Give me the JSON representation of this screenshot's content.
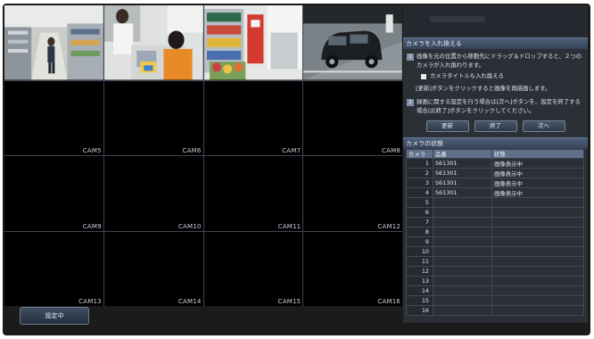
{
  "grid": {
    "cameras": [
      {
        "label": ""
      },
      {
        "label": ""
      },
      {
        "label": ""
      },
      {
        "label": ""
      },
      {
        "label": "CAM5"
      },
      {
        "label": "CAM6"
      },
      {
        "label": "CAM7"
      },
      {
        "label": "CAM8"
      },
      {
        "label": "CAM9"
      },
      {
        "label": "CAM10"
      },
      {
        "label": "CAM11"
      },
      {
        "label": "CAM12"
      },
      {
        "label": "CAM13"
      },
      {
        "label": "CAM14"
      },
      {
        "label": "CAM15"
      },
      {
        "label": "CAM16"
      }
    ]
  },
  "status_button": "設定中",
  "swap_section": {
    "header": "カメラを入れ換える",
    "step1_num": "1",
    "step1_text": "画像を元の位置から移動先にドラッグ＆ドロップすると、２つのカメラが入れ換わります。",
    "checkbox_label": "カメラタイトルも入れ換える",
    "refresh_note": "[更新]ボタンをクリックすると画像を再描画します。",
    "step2_num": "2",
    "step2_text": "録画に関する設定を行う場合は[次へ]ボタンを、設定を終了する場合は[終了]ボタンをクリックしてください。",
    "buttons": {
      "refresh": "更新",
      "finish": "終了",
      "next": "次へ"
    }
  },
  "status_section": {
    "header": "カメラの状態",
    "columns": {
      "camera": "カメラ",
      "model": "品番",
      "state": "状態"
    },
    "rows": [
      {
        "num": "1",
        "model": "S61301",
        "state": "画像表示中"
      },
      {
        "num": "2",
        "model": "S61301",
        "state": "画像表示中"
      },
      {
        "num": "3",
        "model": "S61301",
        "state": "画像表示中"
      },
      {
        "num": "4",
        "model": "S61301",
        "state": "画像表示中"
      },
      {
        "num": "5",
        "model": "",
        "state": ""
      },
      {
        "num": "6",
        "model": "",
        "state": ""
      },
      {
        "num": "7",
        "model": "",
        "state": ""
      },
      {
        "num": "8",
        "model": "",
        "state": ""
      },
      {
        "num": "9",
        "model": "",
        "state": ""
      },
      {
        "num": "10",
        "model": "",
        "state": ""
      },
      {
        "num": "11",
        "model": "",
        "state": ""
      },
      {
        "num": "12",
        "model": "",
        "state": ""
      },
      {
        "num": "13",
        "model": "",
        "state": ""
      },
      {
        "num": "14",
        "model": "",
        "state": ""
      },
      {
        "num": "15",
        "model": "",
        "state": ""
      },
      {
        "num": "16",
        "model": "",
        "state": ""
      }
    ]
  }
}
